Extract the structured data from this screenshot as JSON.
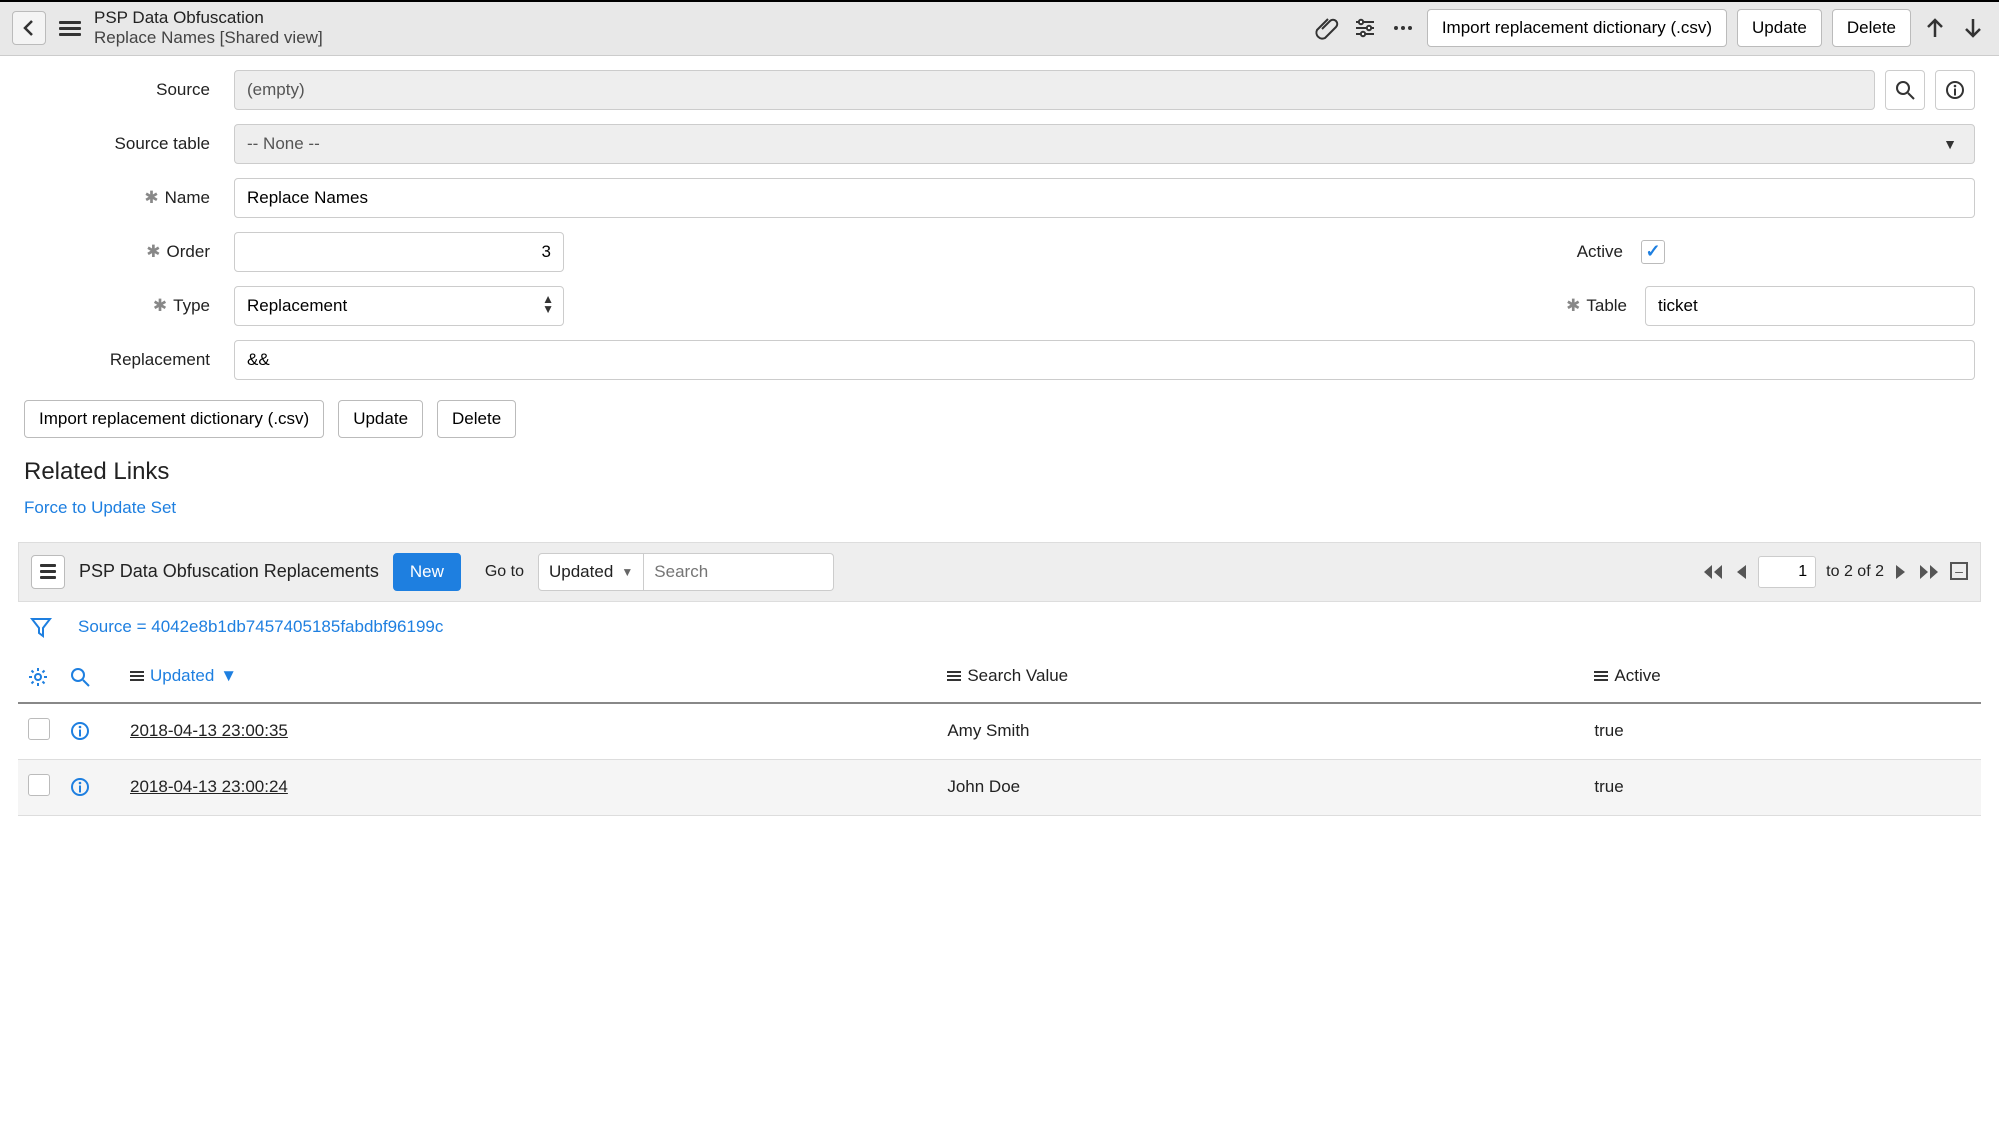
{
  "header": {
    "title": "PSP Data Obfuscation",
    "subtitle": "Replace Names [Shared view]",
    "buttons": {
      "import": "Import replacement dictionary (.csv)",
      "update": "Update",
      "delete": "Delete"
    }
  },
  "form": {
    "labels": {
      "source": "Source",
      "source_table": "Source table",
      "name": "Name",
      "order": "Order",
      "type": "Type",
      "replacement": "Replacement",
      "active": "Active",
      "table": "Table"
    },
    "values": {
      "source": "(empty)",
      "source_table": "-- None --",
      "name": "Replace Names",
      "order": "3",
      "type": "Replacement",
      "replacement": "&&",
      "active_checked": "✓",
      "table": "ticket"
    }
  },
  "actions": {
    "import": "Import replacement dictionary (.csv)",
    "update": "Update",
    "delete": "Delete"
  },
  "related": {
    "heading": "Related Links",
    "link1": "Force to Update Set"
  },
  "list": {
    "title": "PSP Data Obfuscation Replacements",
    "new_btn": "New",
    "goto": "Go to",
    "goto_field": "Updated",
    "search_placeholder": "Search",
    "page_value": "1",
    "page_text": "to 2 of 2",
    "filter": "Source = 4042e8b1db7457405185fabdbf96199c",
    "columns": {
      "updated": "Updated",
      "search_value": "Search Value",
      "active": "Active"
    },
    "rows": [
      {
        "updated": "2018-04-13 23:00:35",
        "search_value": "Amy Smith",
        "active": "true"
      },
      {
        "updated": "2018-04-13 23:00:24",
        "search_value": "John Doe",
        "active": "true"
      }
    ]
  }
}
